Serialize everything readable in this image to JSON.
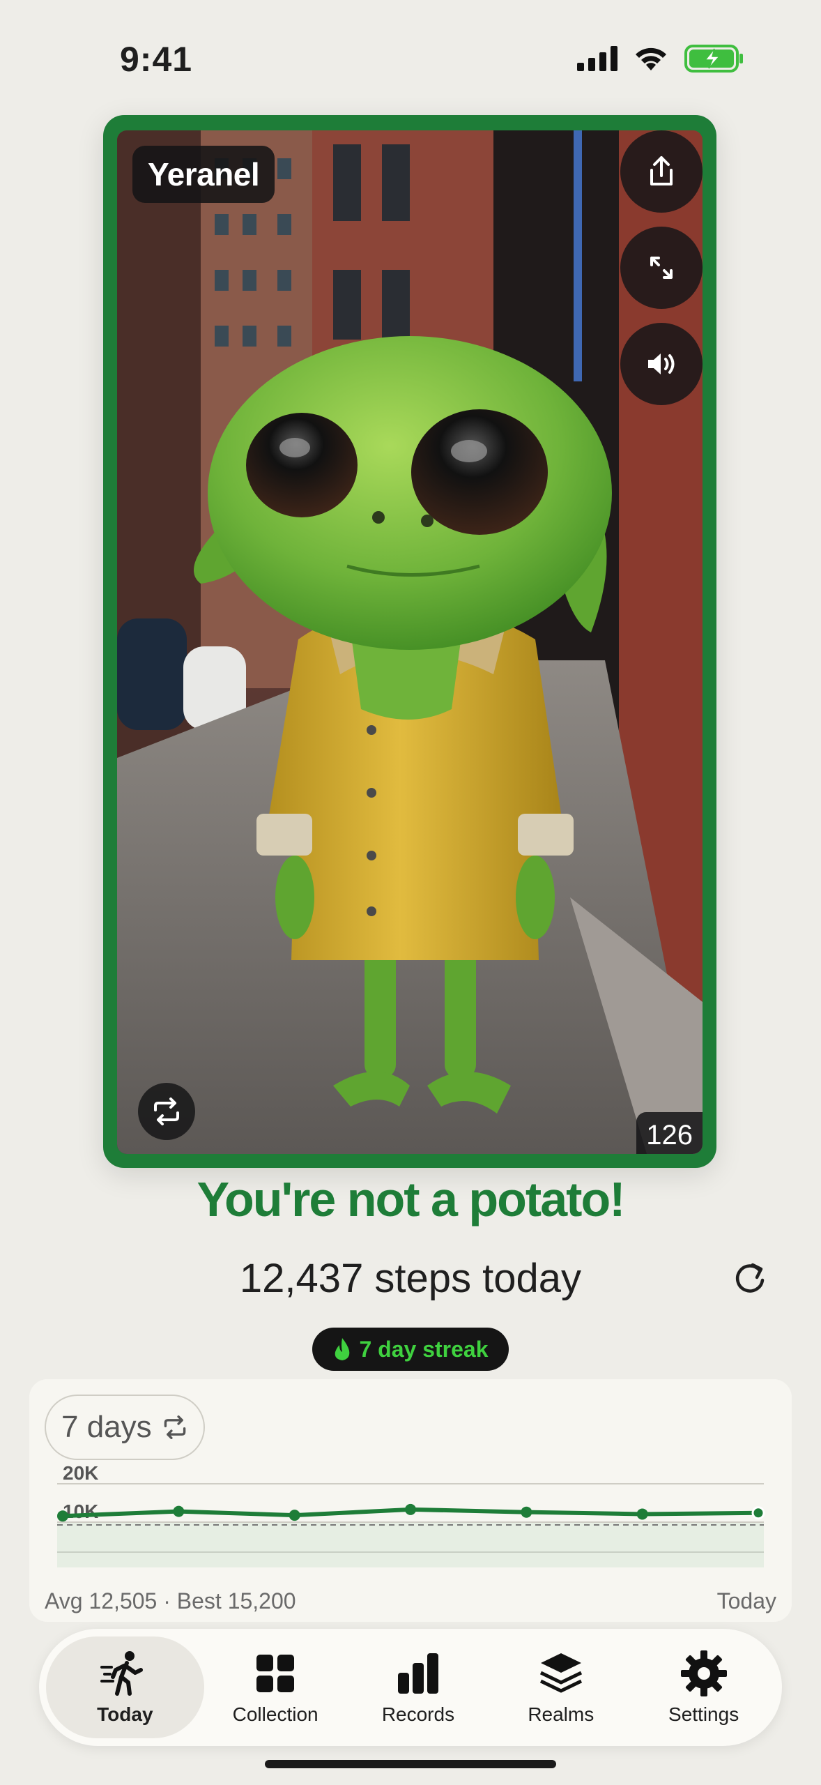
{
  "status_bar": {
    "time": "9:41"
  },
  "creature": {
    "name": "Yeranel",
    "count": "126",
    "frame_color": "#1e7d38"
  },
  "headline": "You're not a potato!",
  "steps_text": "12,437 steps today",
  "streak": {
    "label": "7 day streak",
    "color": "#3fd13f"
  },
  "chart_panel": {
    "range_label": "7 days",
    "footer_left": "Avg 12,505 · Best 15,200",
    "footer_right": "Today"
  },
  "chart_data": {
    "type": "line",
    "x": [
      1,
      2,
      3,
      4,
      5,
      6,
      7
    ],
    "values": [
      11600,
      12800,
      11800,
      13300,
      12600,
      12100,
      12400
    ],
    "y_ticks": [
      "20K",
      "10K"
    ],
    "ylim": [
      0,
      20000
    ],
    "goal_line": 10000,
    "line_color": "#1e7d38"
  },
  "tabs": [
    {
      "label": "Today",
      "icon": "walking-person-icon",
      "active": true
    },
    {
      "label": "Collection",
      "icon": "grid-icon",
      "active": false
    },
    {
      "label": "Records",
      "icon": "bar-chart-icon",
      "active": false
    },
    {
      "label": "Realms",
      "icon": "layers-icon",
      "active": false
    },
    {
      "label": "Settings",
      "icon": "gear-icon",
      "active": false
    }
  ]
}
